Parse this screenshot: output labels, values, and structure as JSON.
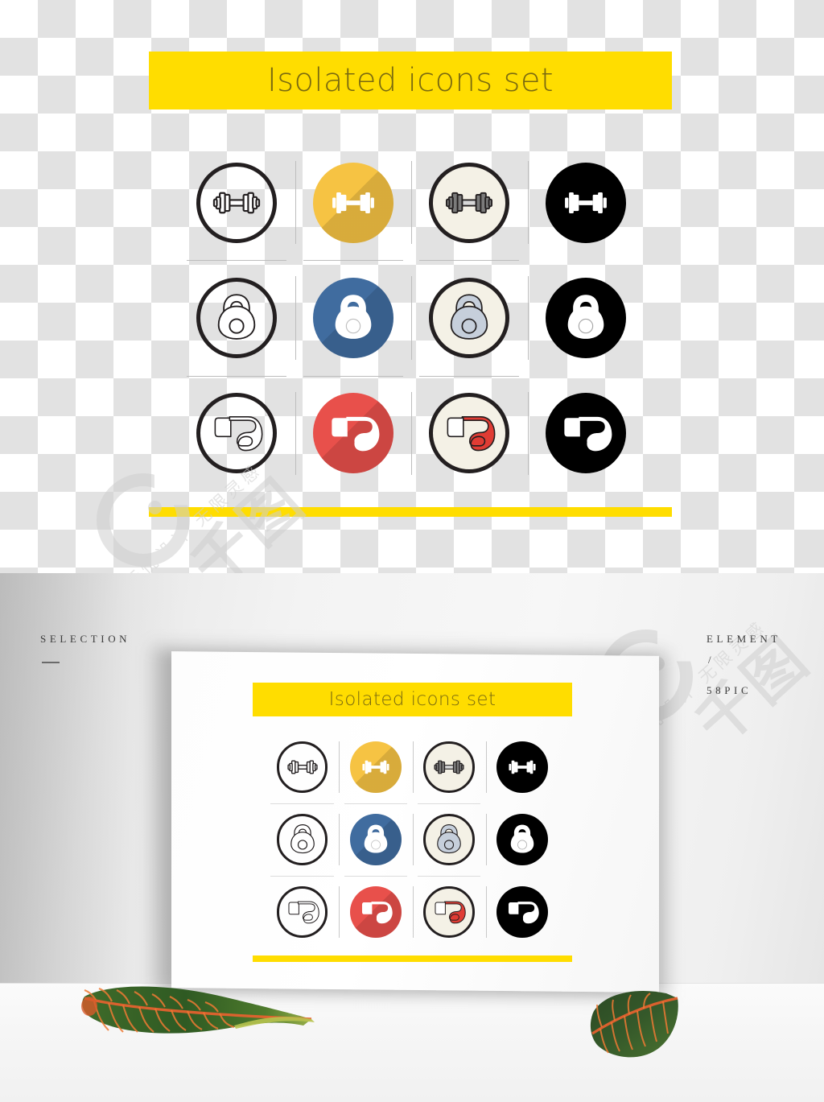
{
  "artboard": {
    "title": "Isolated icons set",
    "background": "transparent-checkerboard",
    "accent_color": "#ffdd00"
  },
  "poster": {
    "title": "Isolated icons set",
    "accent_color": "#ffdd00"
  },
  "icon_set": {
    "rows": [
      {
        "name": "dumbbell",
        "items": [
          {
            "style": "line",
            "icon": "dumbbell-icon",
            "circle_fill": "transparent",
            "circle_stroke": "#231f20",
            "glyph_color": "#231f20"
          },
          {
            "style": "flat",
            "icon": "dumbbell-icon",
            "circle_fill": "#f6c343",
            "circle_stroke": "none",
            "glyph_color": "#ffffff"
          },
          {
            "style": "color",
            "icon": "dumbbell-icon",
            "circle_fill": "#f4f1e6",
            "circle_stroke": "#231f20",
            "glyph_color": "#7b7b7b"
          },
          {
            "style": "glyph",
            "icon": "dumbbell-icon",
            "circle_fill": "#000000",
            "circle_stroke": "none",
            "glyph_color": "#ffffff"
          }
        ]
      },
      {
        "name": "kettlebell",
        "items": [
          {
            "style": "line",
            "icon": "kettlebell-icon",
            "circle_fill": "transparent",
            "circle_stroke": "#231f20",
            "glyph_color": "#231f20"
          },
          {
            "style": "flat",
            "icon": "kettlebell-icon",
            "circle_fill": "#406c9f",
            "circle_stroke": "none",
            "glyph_color": "#ffffff"
          },
          {
            "style": "color",
            "icon": "kettlebell-icon",
            "circle_fill": "#f4f1e6",
            "circle_stroke": "#231f20",
            "glyph_color": "#c6cfdb"
          },
          {
            "style": "glyph",
            "icon": "kettlebell-icon",
            "circle_fill": "#000000",
            "circle_stroke": "none",
            "glyph_color": "#ffffff"
          }
        ]
      },
      {
        "name": "boxing-glove",
        "items": [
          {
            "style": "line",
            "icon": "boxing-glove-icon",
            "circle_fill": "transparent",
            "circle_stroke": "#231f20",
            "glyph_color": "#231f20"
          },
          {
            "style": "flat",
            "icon": "boxing-glove-icon",
            "circle_fill": "#e8504b",
            "circle_stroke": "none",
            "glyph_color": "#ffffff"
          },
          {
            "style": "color",
            "icon": "boxing-glove-icon",
            "circle_fill": "#f4f1e6",
            "circle_stroke": "#231f20",
            "glyph_color": "#e03c34"
          },
          {
            "style": "glyph",
            "icon": "boxing-glove-icon",
            "circle_fill": "#000000",
            "circle_stroke": "none",
            "glyph_color": "#ffffff"
          }
        ]
      }
    ]
  },
  "labels": {
    "selection": "SELECTION",
    "element": "ELEMENT",
    "slash": "/",
    "count": "58PIC"
  },
  "watermark": {
    "brand_cn": "千图",
    "tagline_cn": "无忧设计 无限灵感"
  }
}
